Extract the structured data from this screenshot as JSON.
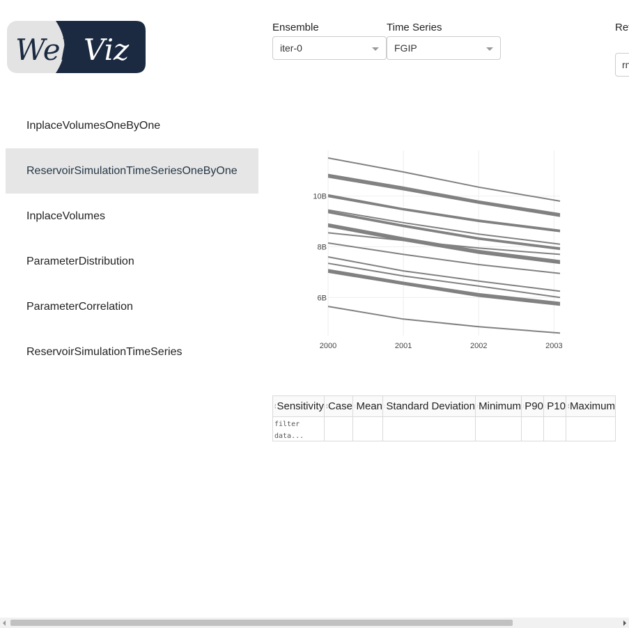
{
  "logo": {
    "text_web": "Web",
    "text_viz": "Viz"
  },
  "controls": {
    "ensemble": {
      "label": "Ensemble",
      "value": "iter-0"
    },
    "time_series": {
      "label": "Time Series",
      "value": "FGIP"
    },
    "reference": {
      "label": "Ref",
      "value": "rn"
    }
  },
  "nav": {
    "items": [
      {
        "label": "InplaceVolumesOneByOne",
        "active": false
      },
      {
        "label": "ReservoirSimulationTimeSeriesOneByOne",
        "active": true
      },
      {
        "label": "InplaceVolumes",
        "active": false
      },
      {
        "label": "ParameterDistribution",
        "active": false
      },
      {
        "label": "ParameterCorrelation",
        "active": false
      },
      {
        "label": "ReservoirSimulationTimeSeries",
        "active": false
      }
    ]
  },
  "chart_data": {
    "type": "line",
    "title": "",
    "xlabel": "",
    "ylabel": "",
    "x": [
      2000,
      2001,
      2002,
      2003
    ],
    "xlim": [
      2000,
      2003.08
    ],
    "ylim": [
      4500000000,
      11800000000
    ],
    "x_ticks": [
      "2000",
      "2001",
      "2002",
      "2003"
    ],
    "y_ticks": [
      {
        "value": 6000000000,
        "label": "6B"
      },
      {
        "value": 8000000000,
        "label": "8B"
      },
      {
        "value": 10000000000,
        "label": "10B"
      }
    ],
    "line_color": "#808080",
    "series": [
      {
        "values": [
          11500000000,
          10950000000,
          10350000000,
          9800000000
        ]
      },
      {
        "values": [
          10850000000,
          10350000000,
          9800000000,
          9300000000
        ]
      },
      {
        "values": [
          10800000000,
          10300000000,
          9750000000,
          9250000000
        ]
      },
      {
        "values": [
          10750000000,
          10250000000,
          9720000000,
          9200000000
        ]
      },
      {
        "values": [
          10050000000,
          9500000000,
          9050000000,
          8650000000
        ]
      },
      {
        "values": [
          10000000000,
          9480000000,
          9030000000,
          8620000000
        ]
      },
      {
        "values": [
          9980000000,
          9460000000,
          9000000000,
          8600000000
        ]
      },
      {
        "values": [
          9450000000,
          8950000000,
          8500000000,
          8100000000
        ]
      },
      {
        "values": [
          9400000000,
          8850000000,
          8350000000,
          7950000000
        ]
      },
      {
        "values": [
          9350000000,
          8800000000,
          8300000000,
          7900000000
        ]
      },
      {
        "values": [
          8900000000,
          8350000000,
          7850000000,
          7450000000
        ]
      },
      {
        "values": [
          8850000000,
          8300000000,
          7800000000,
          7400000000
        ]
      },
      {
        "values": [
          8820000000,
          8280000000,
          7780000000,
          7380000000
        ]
      },
      {
        "values": [
          8800000000,
          8250000000,
          7750000000,
          7350000000
        ]
      },
      {
        "values": [
          8550000000,
          8250000000,
          7950000000,
          7700000000
        ]
      },
      {
        "values": [
          8150000000,
          7700000000,
          7300000000,
          6950000000
        ]
      },
      {
        "values": [
          7600000000,
          7050000000,
          6650000000,
          6250000000
        ]
      },
      {
        "values": [
          7350000000,
          6850000000,
          6450000000,
          6000000000
        ]
      },
      {
        "values": [
          7100000000,
          6600000000,
          6150000000,
          5800000000
        ]
      },
      {
        "values": [
          7050000000,
          6550000000,
          6100000000,
          5750000000
        ]
      },
      {
        "values": [
          7000000000,
          6520000000,
          6050000000,
          5700000000
        ]
      },
      {
        "values": [
          5650000000,
          5150000000,
          4850000000,
          4600000000
        ]
      }
    ]
  },
  "table": {
    "columns": [
      "Sensitivity",
      "Case",
      "Mean",
      "Standard Deviation",
      "Minimum",
      "P90",
      "P10",
      "Maximum"
    ],
    "filter_placeholder": "filter data..."
  }
}
